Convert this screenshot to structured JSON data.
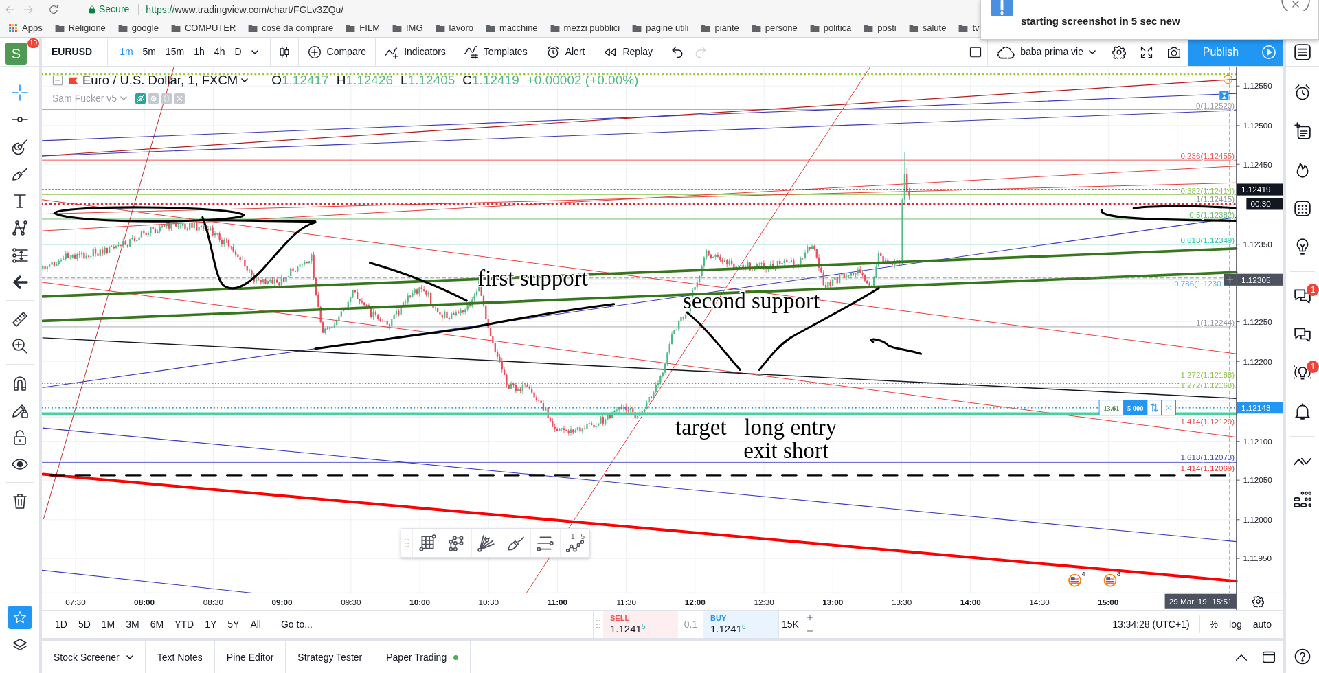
{
  "browser": {
    "security_label": "Secure",
    "url_scheme": "https://",
    "url_path": "www.tradingview.com/chart/FGLv3ZQu/",
    "bookmarks": [
      {
        "kind": "apps",
        "label": "Apps"
      },
      {
        "kind": "folder",
        "label": "Religione"
      },
      {
        "kind": "folder",
        "label": "google"
      },
      {
        "kind": "folder",
        "label": "COMPUTER"
      },
      {
        "kind": "folder",
        "label": "cose da comprare"
      },
      {
        "kind": "folder",
        "label": "FILM"
      },
      {
        "kind": "folder",
        "label": "IMG"
      },
      {
        "kind": "folder",
        "label": "lavoro"
      },
      {
        "kind": "folder",
        "label": "macchine"
      },
      {
        "kind": "folder",
        "label": "mezzi pubblici"
      },
      {
        "kind": "folder",
        "label": "pagine utili"
      },
      {
        "kind": "folder",
        "label": "piante"
      },
      {
        "kind": "folder",
        "label": "persone"
      },
      {
        "kind": "folder",
        "label": "politica"
      },
      {
        "kind": "folder",
        "label": "posti"
      },
      {
        "kind": "folder",
        "label": "salute"
      },
      {
        "kind": "folder",
        "label": "tv"
      }
    ]
  },
  "notification": {
    "message": "starting screenshot in 5 sec new"
  },
  "top_toolbar": {
    "avatar_letter": "S",
    "avatar_badge": "10",
    "symbol": "EURUSD",
    "intervals": [
      {
        "label": "1m",
        "selected": true
      },
      {
        "label": "5m",
        "selected": false
      },
      {
        "label": "15m",
        "selected": false
      },
      {
        "label": "1h",
        "selected": false
      },
      {
        "label": "4h",
        "selected": false
      },
      {
        "label": "D",
        "selected": false
      }
    ],
    "tools": [
      {
        "kind": "compare",
        "label": "Compare"
      },
      {
        "kind": "indicators",
        "label": "Indicators"
      },
      {
        "kind": "templates",
        "label": "Templates"
      },
      {
        "kind": "alert",
        "label": "Alert"
      },
      {
        "kind": "replay",
        "label": "Replay"
      }
    ],
    "history": [
      {
        "kind": "undo",
        "disabled": false
      },
      {
        "kind": "redo",
        "disabled": true
      }
    ],
    "layout_name": "baba prima vie",
    "publish_label": "Publish"
  },
  "left_toolbar": {
    "groups": [
      [
        {
          "kind": "crosshair",
          "selected": true
        },
        {
          "kind": "trend-line",
          "selected": false
        },
        {
          "kind": "fib",
          "selected": false
        },
        {
          "kind": "brush",
          "selected": false
        },
        {
          "kind": "text",
          "selected": false
        },
        {
          "kind": "pattern",
          "selected": false
        },
        {
          "kind": "measure",
          "selected": false
        },
        {
          "kind": "back",
          "selected": false
        }
      ],
      [
        {
          "kind": "ruler",
          "selected": false
        },
        {
          "kind": "zoom",
          "selected": false
        }
      ],
      [
        {
          "kind": "magnet",
          "selected": false
        },
        {
          "kind": "pencil-lock",
          "selected": false
        },
        {
          "kind": "lock",
          "selected": false
        },
        {
          "kind": "eye",
          "selected": false
        }
      ],
      [
        {
          "kind": "trash",
          "selected": false
        }
      ]
    ]
  },
  "legend": {
    "title": "Euro / U.S. Dollar, 1, FXCM",
    "ohlc": [
      {
        "letter": "O",
        "value": "1.12417"
      },
      {
        "letter": "H",
        "value": "1.12426"
      },
      {
        "letter": "L",
        "value": "1.12405"
      },
      {
        "letter": "C",
        "value": "1.12419"
      }
    ],
    "change": "+0.00002 (+0.00%)",
    "indicator": "Sam Fucker v5"
  },
  "chart": {
    "price_scale": [
      "1.12550",
      "1.12500",
      "1.12450",
      "1.12350",
      "1.12250",
      "1.12200",
      "1.12100",
      "1.12050",
      "1.12000",
      "1.11950"
    ],
    "price_badges": [
      {
        "kind": "last",
        "text": "1.12419"
      },
      {
        "kind": "countdown",
        "text": "00:30"
      },
      {
        "kind": "crosshair",
        "text": "1.12305"
      },
      {
        "kind": "line",
        "text": "1.12143"
      }
    ],
    "time_scale": [
      {
        "label": "07:30",
        "bold": false
      },
      {
        "label": "08:00",
        "bold": true
      },
      {
        "label": "08:30",
        "bold": false
      },
      {
        "label": "09:00",
        "bold": true
      },
      {
        "label": "09:30",
        "bold": false
      },
      {
        "label": "10:00",
        "bold": true
      },
      {
        "label": "10:30",
        "bold": false
      },
      {
        "label": "11:00",
        "bold": true
      },
      {
        "label": "11:30",
        "bold": false
      },
      {
        "label": "12:00",
        "bold": true
      },
      {
        "label": "12:30",
        "bold": false
      },
      {
        "label": "13:00",
        "bold": true
      },
      {
        "label": "13:30",
        "bold": false
      },
      {
        "label": "14:00",
        "bold": true
      },
      {
        "label": "14:30",
        "bold": false
      },
      {
        "label": "15:00",
        "bold": true
      }
    ],
    "crosshair_time": {
      "date": "29 Mar '19",
      "time": "15:51"
    },
    "fib_labels": [
      {
        "text": "0(1.12520)",
        "color": "#9598a1"
      },
      {
        "text": "0.236(1.12455)",
        "color": "#ef5350"
      },
      {
        "text": "0.382(1.12414)",
        "color": "#8bc34a"
      },
      {
        "text": "1(1.12415)",
        "color": "#9598a1"
      },
      {
        "text": "0.5(1.12382)",
        "color": "#66bb6a"
      },
      {
        "text": "0.618(1.12349)",
        "color": "#26c6a0"
      },
      {
        "text": "0.786(1.1230",
        "color": "#64b5f6"
      },
      {
        "text": "1(1.12244)",
        "color": "#9598a1"
      },
      {
        "text": "1.272(1.12188)",
        "color": "#8bc34a"
      },
      {
        "text": "1.272(1.12168)",
        "color": "#8bc34a"
      },
      {
        "text": "1.414(1.12129)",
        "color": "#ef5350"
      },
      {
        "text": "1.618(1.12073)",
        "color": "#3949ab"
      },
      {
        "text": "1.414(1.12069)",
        "color": "#e53935"
      }
    ],
    "annotations": [
      "first support",
      "second support",
      "target",
      "long entry",
      "exit short"
    ],
    "order_line": {
      "profit": "13.61",
      "quantity": "5 000"
    },
    "event_markers": [
      {
        "count": "4"
      },
      {
        "count": "8"
      }
    ]
  },
  "drawing_toolbar": {
    "wave_marks": [
      "1",
      "5"
    ]
  },
  "bottom_toolbar": {
    "ranges": [
      "1D",
      "5D",
      "1M",
      "3M",
      "6M",
      "YTD",
      "1Y",
      "5Y",
      "All"
    ],
    "goto_label": "Go to...",
    "sell": {
      "label": "SELL",
      "price": "1.1241$^{5}$"
    },
    "spread": "0.1",
    "buy": {
      "label": "BUY",
      "price": "1.1241$^{6}$"
    },
    "quantity": "15K",
    "clock": "13:34:28 (UTC+1)",
    "scale_options": [
      "%",
      "log",
      "auto"
    ]
  },
  "bottom_tabs": [
    {
      "label": "Stock Screener",
      "dropdown": true,
      "online": false
    },
    {
      "label": "Text Notes",
      "dropdown": false,
      "online": false
    },
    {
      "label": "Pine Editor",
      "dropdown": false,
      "online": false
    },
    {
      "label": "Strategy Tester",
      "dropdown": false,
      "online": false
    },
    {
      "label": "Paper Trading",
      "dropdown": false,
      "online": true
    }
  ],
  "right_sidebar": {
    "groups": [
      [
        {
          "kind": "watchlist"
        }
      ],
      [
        {
          "kind": "alarm"
        },
        {
          "kind": "data"
        },
        {
          "kind": "flame"
        },
        {
          "kind": "calendar"
        },
        {
          "kind": "idea"
        }
      ],
      [
        {
          "kind": "chats",
          "badge": "1"
        },
        {
          "kind": "chat"
        },
        {
          "kind": "stream",
          "badge": "1"
        },
        {
          "kind": "bell"
        }
      ],
      [
        {
          "kind": "chevrons"
        },
        {
          "kind": "dots"
        }
      ]
    ]
  }
}
